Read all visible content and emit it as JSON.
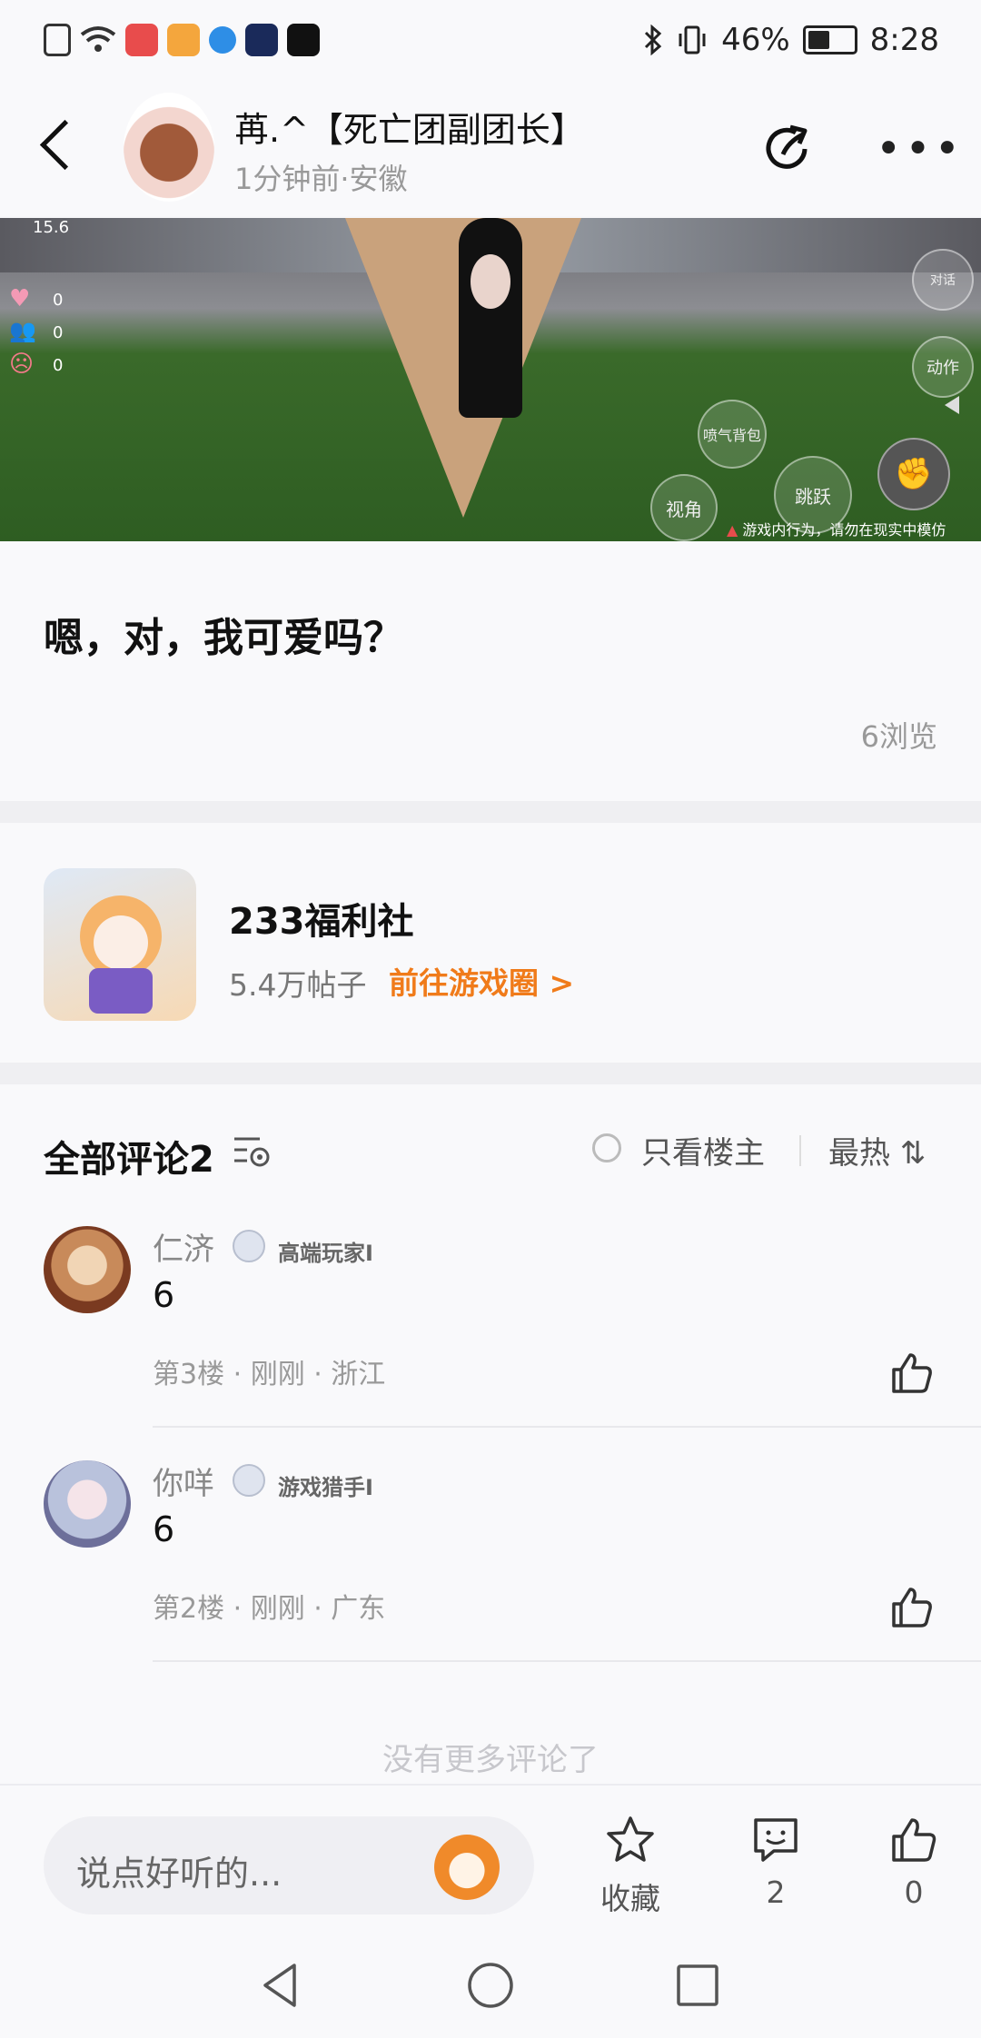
{
  "status_bar": {
    "battery": "46%",
    "time": "8:28"
  },
  "header": {
    "title": "苒.^【死亡团副团长】",
    "subtitle": "1分钟前·安徽"
  },
  "video": {
    "stats": [
      "15.6",
      "0",
      "0",
      "0"
    ],
    "buttons": [
      "喷气背包",
      "跳跃",
      "视角",
      "对话",
      "动作"
    ],
    "warning": "游戏内行为，请勿在现实中模仿"
  },
  "post": {
    "text": "嗯，对，我可爱吗？",
    "views": "6浏览"
  },
  "circle": {
    "name": "233福利社",
    "posts": "5.4万帖子",
    "link": "前往游戏圈 >"
  },
  "comments": {
    "header": "全部评论2",
    "only_op": "只看楼主",
    "sort": "最热 ⇅",
    "items": [
      {
        "name": "仁济",
        "badge": "高端玩家I",
        "text": "6",
        "meta": "第3楼 · 刚刚 · 浙江"
      },
      {
        "name": "你咩",
        "badge": "游戏猎手I",
        "text": "6",
        "meta": "第2楼 · 刚刚 · 广东"
      }
    ],
    "no_more": "没有更多评论了"
  },
  "bottom_bar": {
    "placeholder": "说点好听的...",
    "favorite_label": "收藏",
    "comment_count": "2",
    "like_count": "0"
  },
  "colors": {
    "accent": "#f07b1a",
    "background": "#f9f9fb"
  }
}
